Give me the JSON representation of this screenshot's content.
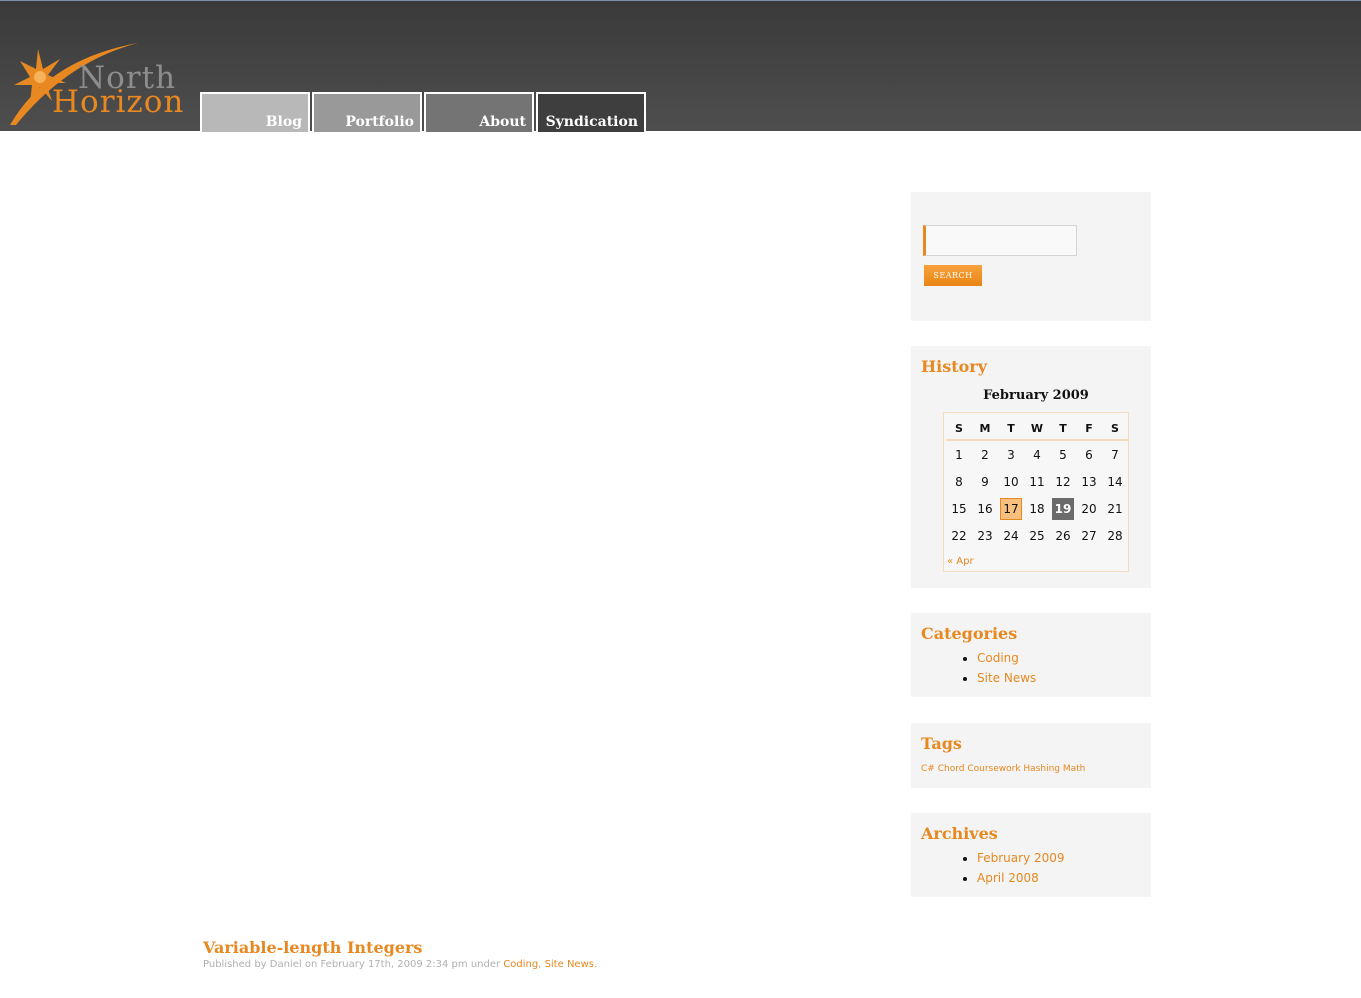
{
  "header": {
    "logo_top": "North",
    "logo_bottom": "Horizon",
    "nav": [
      {
        "label": "Blog"
      },
      {
        "label": "Portfolio"
      },
      {
        "label": "About"
      },
      {
        "label": "Syndication"
      }
    ]
  },
  "search": {
    "value": "",
    "placeholder": "",
    "button_label": "SEARCH"
  },
  "history": {
    "title": "History",
    "caption": "February 2009",
    "weekdays": [
      "S",
      "M",
      "T",
      "W",
      "T",
      "F",
      "S"
    ],
    "weeks": [
      [
        "1",
        "2",
        "3",
        "4",
        "5",
        "6",
        "7"
      ],
      [
        "8",
        "9",
        "10",
        "11",
        "12",
        "13",
        "14"
      ],
      [
        "15",
        "16",
        "17",
        "18",
        "19",
        "20",
        "21"
      ],
      [
        "22",
        "23",
        "24",
        "25",
        "26",
        "27",
        "28"
      ]
    ],
    "highlighted_day": "17",
    "selected_day": "19",
    "prev_link": "« Apr"
  },
  "categories": {
    "title": "Categories",
    "items": [
      "Coding",
      "Site News"
    ]
  },
  "tags": {
    "title": "Tags",
    "items": [
      "C#",
      "Chord",
      "Coursework",
      "Hashing",
      "Math"
    ]
  },
  "archives": {
    "title": "Archives",
    "items": [
      "February 2009",
      "April 2008"
    ]
  },
  "post": {
    "title": "Variable-length Integers",
    "meta_prefix": "Published by Daniel on February 17th, 2009 2:34 pm under ",
    "categories": [
      "Coding",
      "Site News"
    ],
    "meta_sep": ", ",
    "meta_end": ".",
    "body_excerpt": ""
  },
  "colors": {
    "accent": "#e78820",
    "header_bg": "#444444",
    "widget_bg": "#f4f4f4"
  }
}
